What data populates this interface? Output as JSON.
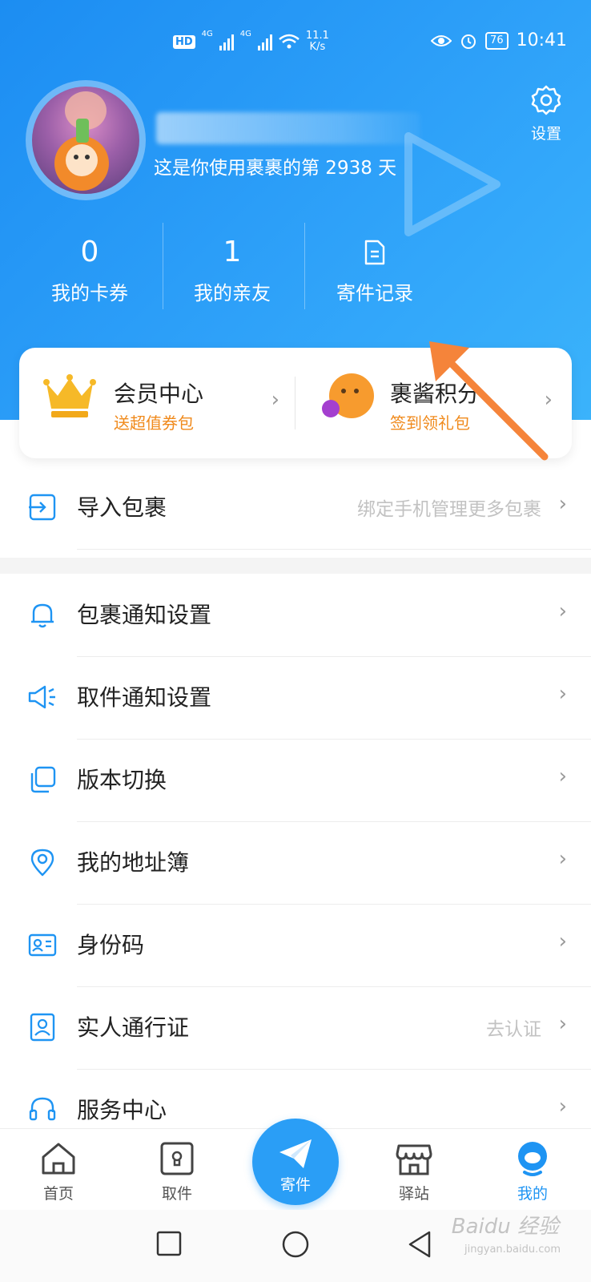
{
  "status_bar": {
    "hd": "HD",
    "net1": "4G",
    "net2": "4G",
    "speed_value": "11.1",
    "speed_unit": "K/s",
    "battery": "76",
    "time": "10:41"
  },
  "header": {
    "settings_label": "设置",
    "days_text": "这是你使用裹裹的第 2938 天"
  },
  "stats": [
    {
      "value": "0",
      "label": "我的卡券"
    },
    {
      "value": "1",
      "label": "我的亲友"
    },
    {
      "icon": "document-icon",
      "label": "寄件记录"
    }
  ],
  "promo_cards": [
    {
      "icon": "crown-icon",
      "title": "会员中心",
      "subtitle": "送超值券包"
    },
    {
      "icon": "mascot-icon",
      "title": "裹酱积分",
      "subtitle": "签到领礼包"
    }
  ],
  "menu": [
    {
      "icon": "import-icon",
      "label": "导入包裹",
      "hint": "绑定手机管理更多包裹"
    },
    {
      "icon": "bell-icon",
      "label": "包裹通知设置",
      "hint": ""
    },
    {
      "icon": "speaker-icon",
      "label": "取件通知设置",
      "hint": ""
    },
    {
      "icon": "copy-icon",
      "label": "版本切换",
      "hint": ""
    },
    {
      "icon": "location-pin-icon",
      "label": "我的地址簿",
      "hint": ""
    },
    {
      "icon": "id-card-icon",
      "label": "身份码",
      "hint": ""
    },
    {
      "icon": "badge-icon",
      "label": "实人通行证",
      "hint": "去认证"
    },
    {
      "icon": "headset-icon",
      "label": "服务中心",
      "hint": ""
    }
  ],
  "bottom_nav": [
    {
      "icon": "home-icon",
      "label": "首页"
    },
    {
      "icon": "locker-icon",
      "label": "取件"
    },
    {
      "icon": "paper-plane-icon",
      "label": "寄件"
    },
    {
      "icon": "store-icon",
      "label": "驿站"
    },
    {
      "icon": "mascot-face-icon",
      "label": "我的",
      "active": true
    }
  ],
  "watermark": {
    "main": "Baidu 经验",
    "sub": "jingyan.baidu.com"
  },
  "colors": {
    "primary": "#1e94f3",
    "accent_orange": "#f08a1c",
    "arrow": "#f5843a"
  }
}
